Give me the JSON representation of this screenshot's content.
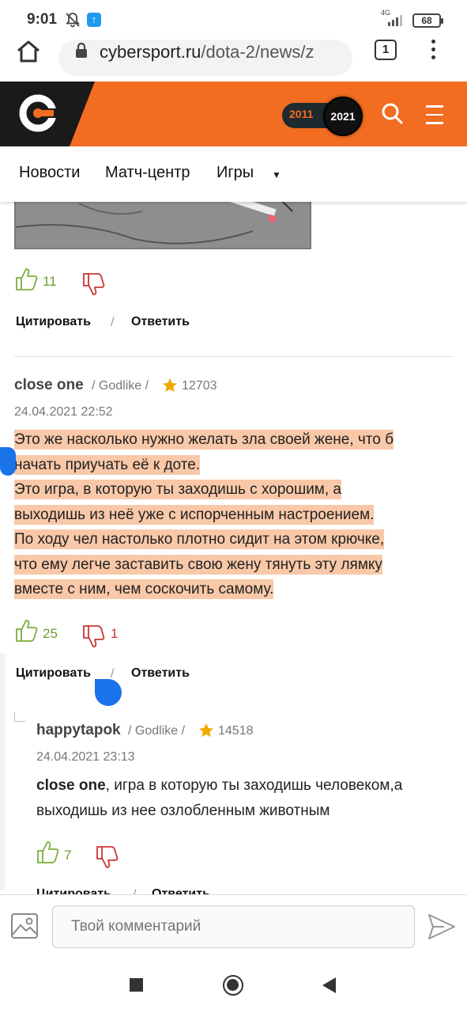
{
  "status_bar": {
    "time": "9:01",
    "network": "4G",
    "battery": "68"
  },
  "browser": {
    "url_host": "cybersport.ru",
    "url_path": "/dota-2/news/z",
    "tab_count": "1"
  },
  "header": {
    "year_old": "2011",
    "year_new": "2021",
    "brand_color": "#f26d21"
  },
  "nav": {
    "items": [
      "Новости",
      "Матч-центр",
      "Игры"
    ],
    "caret": "▼"
  },
  "comments": [
    {
      "votes_up": "11",
      "votes_down": "",
      "quote_label": "Цитировать",
      "reply_label": "Ответить"
    },
    {
      "author": "close one",
      "rank": "Godlike",
      "rating": "12703",
      "date": "24.04.2021 22:52",
      "lines": [
        "Это же насколько нужно желать зла своей жене, что б",
        "начать приучать её к доте.",
        "Это игра, в которую ты заходишь с хорошим, а",
        "выходишь из неё уже с испорченным настроением.",
        "По ходу чел настолько плотно сидит на этом крючке,",
        "что ему легче заставить свою жену тянуть эту лямку",
        "вместе с ним, чем соскочить самому."
      ],
      "votes_up": "25",
      "votes_down": "1",
      "quote_label": "Цитировать",
      "reply_label": "Ответить"
    },
    {
      "author": "happytapok",
      "rank": "Godlike",
      "rating": "14518",
      "date": "24.04.2021 23:13",
      "mention": "close one",
      "text_line1": ", игра в которую ты заходишь человеком,а",
      "text_line2": "выходишь из нее озлобленным животным",
      "votes_up": "7",
      "votes_down": "",
      "quote_label": "Цитировать",
      "reply_label": "Ответить"
    }
  ],
  "separator": "/",
  "comment_input": {
    "placeholder": "Твой комментарий"
  }
}
